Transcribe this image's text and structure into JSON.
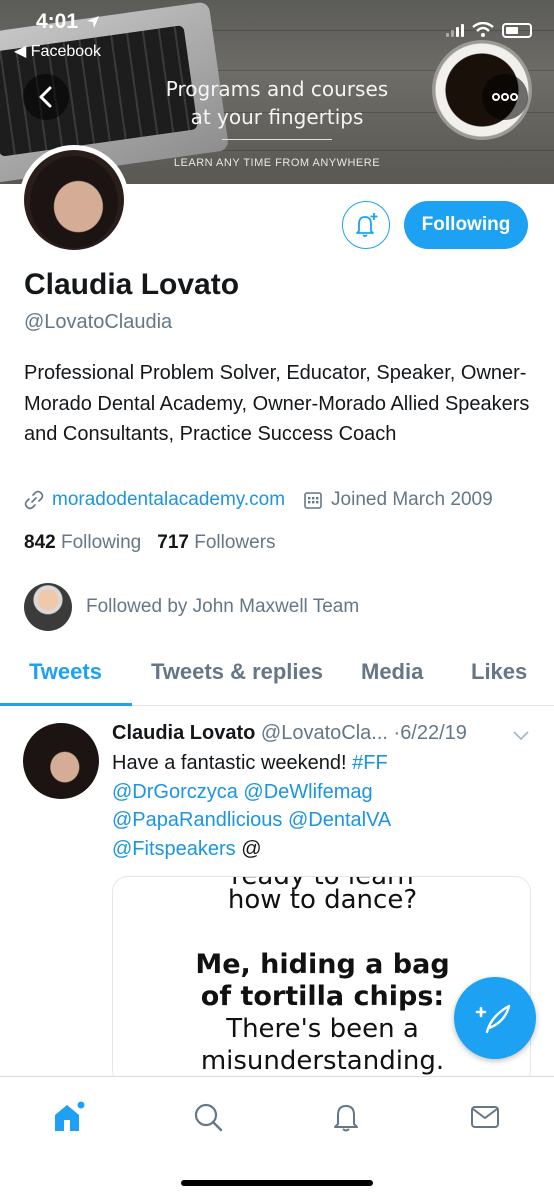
{
  "status_bar": {
    "time": "4:01",
    "back_app": "Facebook"
  },
  "banner": {
    "title_line1": "Programs and courses",
    "title_line2": "at your fingertips",
    "subtitle": "LEARN ANY TIME FROM ANYWHERE"
  },
  "profile": {
    "name": "Claudia Lovato",
    "handle": "@LovatoClaudia",
    "bio": "Professional Problem Solver, Educator, Speaker, Owner- Morado Dental Academy, Owner-Morado Allied Speakers and Consultants, Practice Success Coach",
    "website": "moradodentalacademy.com",
    "joined": "Joined March 2009",
    "following_count": "842",
    "following_label": "Following",
    "followers_count": "717",
    "followers_label": "Followers",
    "followed_by": "Followed by John Maxwell Team",
    "follow_button_label": "Following"
  },
  "tabs": [
    {
      "label": "Tweets",
      "active": true
    },
    {
      "label": "Tweets & replies",
      "active": false
    },
    {
      "label": "Media",
      "active": false
    },
    {
      "label": "Likes",
      "active": false
    }
  ],
  "tweet": {
    "author": "Claudia Lovato",
    "handle_truncated": "@LovatoCla...",
    "date": "6/22/19",
    "text_plain": "Have a fantastic weekend! ",
    "hashtag": "#FF",
    "mentions_line1": "@DrGorczyca @DeWlifemag",
    "mentions_line2": "@PapaRandlicious @DentalVA",
    "mentions_line3": "@Fitspeakers",
    "trailing": " @",
    "image_text": {
      "line1": "ready to learn",
      "line2": "how to dance?",
      "line3": "Me, hiding a bag",
      "line4": "of tortilla chips:",
      "line5": "There's been a",
      "line6": "misunderstanding."
    }
  },
  "colors": {
    "accent": "#1da1f2",
    "link": "#1b95e0",
    "muted": "#657786",
    "text": "#14171a"
  },
  "bottom_nav": [
    "home-icon",
    "search-icon",
    "notifications-icon",
    "messages-icon"
  ]
}
